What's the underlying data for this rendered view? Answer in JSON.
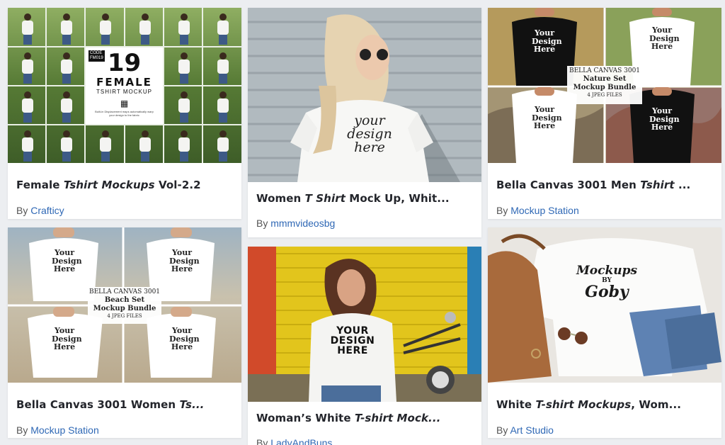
{
  "colors": {
    "page_bg": "#eceef1",
    "card_bg": "#ffffff",
    "title_text": "#23252b",
    "author_link": "#2f68b5"
  },
  "cards": [
    {
      "title_plain": "Female ",
      "title_italic": "Tshirt Mockups",
      "title_rest": " Vol-2.2",
      "by_label": "By",
      "author": "Crafticy",
      "thumb": {
        "code_label": "CODE",
        "code_value": "FM019",
        "count": "19",
        "headline": "FEMALE",
        "subline": "TSHIRT MOCKUP",
        "footnote": "Built-in Displacement maps automatically warp your design to the fabric"
      }
    },
    {
      "title_plain": "Women ",
      "title_italic": "T Shirt",
      "title_rest": " Mock Up, Whit...",
      "by_label": "By",
      "author": "mmmvideosbg",
      "thumb": {
        "shirt_text": "your design here"
      }
    },
    {
      "title_plain": "Bella Canvas 3001 Men ",
      "title_italic": "Tshirt",
      "title_rest": " ...",
      "by_label": "By",
      "author": "Mockup Station",
      "thumb": {
        "shirt_text": "Your Design Here",
        "bundle_line1": "BELLA CANVAS 3001",
        "bundle_line2": "Nature Set",
        "bundle_line3": "Mockup Bundle",
        "bundle_line4": "4 JPEG FILES"
      }
    },
    {
      "title_plain": "Bella Canvas 3001 Women ",
      "title_italic": "Ts...",
      "title_rest": "",
      "by_label": "By",
      "author": "Mockup Station",
      "thumb": {
        "shirt_text": "Your Design Here",
        "bundle_line1": "BELLA CANVAS 3001",
        "bundle_line2": "Beach Set",
        "bundle_line3": "Mockup Bundle",
        "bundle_line4": "4 JPEG FILES"
      }
    },
    {
      "title_plain": "Woman’s White ",
      "title_italic": "T-shirt Mock...",
      "title_rest": "",
      "by_label": "By",
      "author": "LadyAndBuns",
      "thumb": {
        "shirt_text": "YOUR DESIGN HERE"
      }
    },
    {
      "title_plain": "White ",
      "title_italic": "T-shirt Mockups",
      "title_rest": ", Wom...",
      "by_label": "By",
      "author": "Art Studio",
      "thumb": {
        "logo_line1": "Mockups",
        "logo_line2": "BY",
        "logo_line3": "Goby"
      }
    }
  ]
}
